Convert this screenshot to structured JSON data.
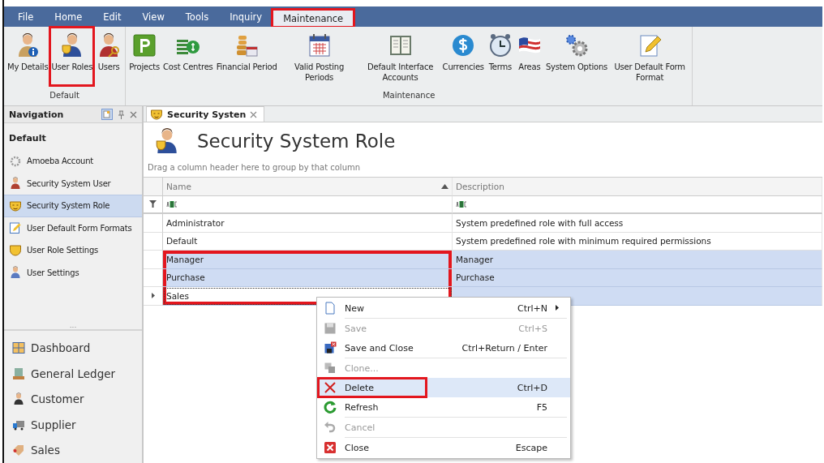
{
  "menu_bar": [
    {
      "label": "File",
      "selected": false,
      "annotated": false
    },
    {
      "label": "Home",
      "selected": false,
      "annotated": false
    },
    {
      "label": "Edit",
      "selected": false,
      "annotated": false
    },
    {
      "label": "View",
      "selected": false,
      "annotated": false
    },
    {
      "label": "Tools",
      "selected": false,
      "annotated": false
    },
    {
      "label": "Inquiry",
      "selected": false,
      "annotated": false
    },
    {
      "label": "Maintenance",
      "selected": true,
      "annotated": true
    }
  ],
  "ribbon": [
    {
      "group": "Default",
      "buttons": [
        {
          "label": "My Details",
          "annotated": false
        },
        {
          "label": "User Roles",
          "annotated": true
        },
        {
          "label": "Users",
          "annotated": false
        }
      ]
    },
    {
      "group": "Maintenance",
      "buttons": [
        {
          "label": "Projects",
          "annotated": false
        },
        {
          "label": "Cost Centres",
          "annotated": false
        },
        {
          "label": "Financial Period",
          "annotated": false
        },
        {
          "label": "Valid Posting Periods",
          "annotated": false
        },
        {
          "label": "Default Interface Accounts",
          "annotated": false
        },
        {
          "label": "Currencies",
          "annotated": false
        },
        {
          "label": "Terms",
          "annotated": false
        },
        {
          "label": "Areas",
          "annotated": false
        },
        {
          "label": "System Options",
          "annotated": false
        },
        {
          "label": "User Default Form Format",
          "annotated": false
        }
      ]
    }
  ],
  "navigation": {
    "title": "Navigation",
    "group": "Default",
    "items": [
      {
        "label": "Amoeba Account",
        "selected": false
      },
      {
        "label": "Security System User",
        "selected": false
      },
      {
        "label": "Security System Role",
        "selected": true
      },
      {
        "label": "User Default Form Formats",
        "selected": false
      },
      {
        "label": "User Role Settings",
        "selected": false
      },
      {
        "label": "User Settings",
        "selected": false
      }
    ],
    "more": "...",
    "modules": [
      "Dashboard",
      "General Ledger",
      "Customer",
      "Supplier",
      "Sales"
    ]
  },
  "document_tab": {
    "label": "Security Systen"
  },
  "page_title": "Security System Role",
  "group_hint": "Drag a column header here to group by that column",
  "table": {
    "columns": [
      {
        "label": "Name",
        "sorted": true
      },
      {
        "label": "Description",
        "sorted": false
      }
    ],
    "rows": [
      {
        "name": "Administrator",
        "description": "System predefined role with full access",
        "selected": false,
        "focused": false,
        "annotated": false
      },
      {
        "name": "Default",
        "description": "System predefined role with minimum required permissions",
        "selected": false,
        "focused": false,
        "annotated": false
      },
      {
        "name": "Manager",
        "description": "Manager",
        "selected": true,
        "focused": false,
        "annotated": true
      },
      {
        "name": "Purchase",
        "description": "Purchase",
        "selected": true,
        "focused": false,
        "annotated": true
      },
      {
        "name": "Sales",
        "selected": true,
        "focused": true,
        "annotated": true
      }
    ]
  },
  "context_menu": [
    {
      "label": "New",
      "shortcut": "Ctrl+N",
      "submenu": true,
      "disabled": false,
      "hovered": false,
      "annotated": false,
      "separator_after": true
    },
    {
      "label": "Save",
      "shortcut": "Ctrl+S",
      "submenu": false,
      "disabled": true,
      "hovered": false,
      "annotated": false,
      "separator_after": false
    },
    {
      "label": "Save and Close",
      "shortcut": "Ctrl+Return / Enter",
      "submenu": false,
      "disabled": false,
      "hovered": false,
      "annotated": false,
      "separator_after": true
    },
    {
      "label": "Clone...",
      "submenu": false,
      "disabled": true,
      "hovered": false,
      "annotated": false,
      "separator_after": false
    },
    {
      "label": "Delete",
      "shortcut": "Ctrl+D",
      "submenu": false,
      "disabled": false,
      "hovered": true,
      "annotated": true,
      "separator_after": false
    },
    {
      "label": "Refresh",
      "shortcut": "F5",
      "submenu": false,
      "disabled": false,
      "hovered": false,
      "annotated": false,
      "separator_after": true
    },
    {
      "label": "Cancel",
      "submenu": false,
      "disabled": true,
      "hovered": false,
      "annotated": false,
      "separator_after": true
    },
    {
      "label": "Close",
      "shortcut": "Escape",
      "submenu": false,
      "disabled": false,
      "hovered": false,
      "annotated": false,
      "separator_after": false
    }
  ]
}
